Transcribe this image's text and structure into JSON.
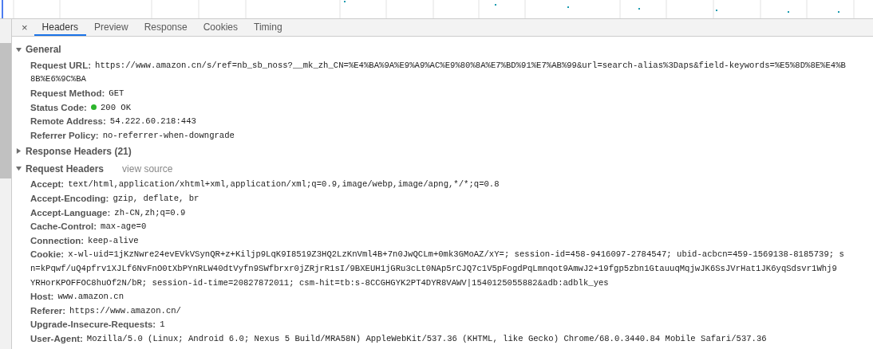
{
  "close_label": "×",
  "tabs": [
    {
      "label": "Headers",
      "selected": true
    },
    {
      "label": "Preview",
      "selected": false
    },
    {
      "label": "Response",
      "selected": false
    },
    {
      "label": "Cookies",
      "selected": false
    },
    {
      "label": "Timing",
      "selected": false
    }
  ],
  "sections": [
    {
      "title": "General",
      "expanded": true,
      "rows": [
        {
          "kind": "text",
          "key": "Request URL:",
          "lines": [
            "https://www.amazon.cn/s/ref=nb_sb_noss?__mk_zh_CN=%E4%BA%9A%E9%A9%AC%E9%80%8A%E7%BD%91%E7%AB%99&url=search-alias%3Daps&field-keywords=%E5%8D%8E%E4%B",
            "8B%E6%9C%BA"
          ]
        },
        {
          "kind": "text",
          "key": "Request Method:",
          "lines": [
            "GET"
          ]
        },
        {
          "kind": "status",
          "key": "Status Code:",
          "lines": [
            "200 OK"
          ]
        },
        {
          "kind": "text",
          "key": "Remote Address:",
          "lines": [
            "54.222.60.218:443"
          ]
        },
        {
          "kind": "text",
          "key": "Referrer Policy:",
          "lines": [
            "no-referrer-when-downgrade"
          ]
        }
      ]
    },
    {
      "title": "Response Headers (21)",
      "expanded": false
    },
    {
      "title": "Request Headers",
      "expanded": true,
      "link": "view source",
      "rows": [
        {
          "kind": "text",
          "key": "Accept:",
          "lines": [
            "text/html,application/xhtml+xml,application/xml;q=0.9,image/webp,image/apng,*/*;q=0.8"
          ]
        },
        {
          "kind": "text",
          "key": "Accept-Encoding:",
          "lines": [
            "gzip, deflate, br"
          ]
        },
        {
          "kind": "text",
          "key": "Accept-Language:",
          "lines": [
            "zh-CN,zh;q=0.9"
          ]
        },
        {
          "kind": "text",
          "key": "Cache-Control:",
          "lines": [
            "max-age=0"
          ]
        },
        {
          "kind": "text",
          "key": "Connection:",
          "lines": [
            "keep-alive"
          ]
        },
        {
          "kind": "text",
          "key": "Cookie:",
          "lines": [
            "x-wl-uid=1jKzNwre24evEVkVSynQR+z+Kiljp9LqK9I8519Z3HQ2LzKnVml4B+7n0JwQCLm+0mk3GMoAZ/xY=; session-id=458-9416097-2784547; ubid-acbcn=459-1569138-8185739; s",
            "n=kPqwf/uQ4pfrv1XJLf6NvFnO0tXbPYnRLW40dtVyfn9SWfbrxr0jZRjrR1sI/9BXEUH1jGRu3cLt0NAp5rCJQ7c1V5pFogdPqLmnqot9AmwJ2+19fgp5zbn1GtauuqMqjwJK6SsJVrHat1JK6yqSdsvr1Whj9",
            "YRHorKPOFFOC8huOf2N/bR; session-id-time=20827872011; csm-hit=tb:s-8CCGHGYK2PT4DYR8VAWV|1540125055882&adb:adblk_yes"
          ]
        },
        {
          "kind": "text",
          "key": "Host:",
          "lines": [
            "www.amazon.cn"
          ]
        },
        {
          "kind": "text",
          "key": "Referer:",
          "lines": [
            "https://www.amazon.cn/"
          ]
        },
        {
          "kind": "text",
          "key": "Upgrade-Insecure-Requests:",
          "lines": [
            "1"
          ]
        },
        {
          "kind": "text",
          "key": "User-Agent:",
          "lines": [
            "Mozilla/5.0 (Linux; Android 6.0; Nexus 5 Build/MRA58N) AppleWebKit/537.36 (KHTML, like Gecko) Chrome/68.0.3440.84 Mobile Safari/537.36"
          ]
        }
      ]
    }
  ]
}
